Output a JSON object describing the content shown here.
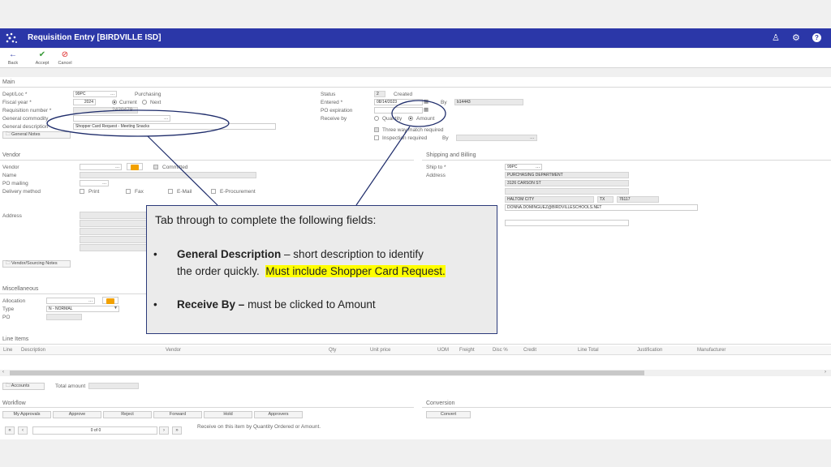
{
  "header": {
    "title": "Requisition Entry [BIRDVILLE ISD]",
    "icons": [
      "user-settings-icon",
      "gear-icon",
      "help-icon"
    ]
  },
  "toolbar": {
    "back": "Back",
    "accept": "Accept",
    "cancel": "Cancel"
  },
  "main": {
    "section": "Main",
    "dept_loc_label": "Dept/Loc *",
    "dept_loc_value": "99PC",
    "dept_loc_desc": "Purchasing",
    "fiscal_year_label": "Fiscal year *",
    "fiscal_year_value": "2024",
    "current_label": "Current",
    "next_label": "Next",
    "req_number_label": "Requisition number *",
    "req_number_value": "2420479",
    "general_commodity_label": "General commodity",
    "general_description_label": "General description",
    "general_description_value": "Shopper Card Request - Meeting Snacks",
    "general_notes_button": "General Notes",
    "status_label": "Status",
    "status_value": "2",
    "status_desc": "Created",
    "entered_label": "Entered *",
    "entered_value": "08/14/2023",
    "entered_by_label": "By",
    "entered_by_value": "b14443",
    "po_expiration_label": "PO expiration",
    "receive_by_label": "Receive by",
    "quantity_label": "Quantity",
    "amount_label": "Amount",
    "three_way_label": "Three way match required",
    "inspection_label": "Inspection required",
    "inspection_by_label": "By"
  },
  "vendor": {
    "section": "Vendor",
    "vendor_label": "Vendor",
    "committed_label": "Committed",
    "name_label": "Name",
    "po_mailing_label": "PO mailing",
    "delivery_method_label": "Delivery method",
    "print_label": "Print",
    "fax_label": "Fax",
    "email_label": "E-Mail",
    "eprocurement_label": "E-Procurement",
    "address_label": "Address",
    "sourcing_notes_button": "Vendor/Sourcing Notes"
  },
  "shipping": {
    "section": "Shipping and Billing",
    "ship_to_label": "Ship to *",
    "ship_to_value": "99PC",
    "address_label": "Address",
    "address_lines": [
      "PURCHASING DEPARTMENT",
      "3126 CARSON ST"
    ],
    "city": "HALTOM CITY",
    "state": "TX",
    "zip": "76117",
    "email": "DONNA.DOMINGUEZ@BIRDVILLESCHOOLS.NET"
  },
  "misc": {
    "section": "Miscellaneous",
    "allocation_label": "Allocation",
    "type_label": "Type",
    "type_value": "N - NORMAL",
    "po_label": "PO"
  },
  "line_items": {
    "section": "Line Items",
    "columns": [
      "Line",
      "Description",
      "Vendor",
      "Qty",
      "Unit price",
      "UOM",
      "Freight",
      "Disc %",
      "Credit",
      "Line Total",
      "Justification",
      "Manufacturer"
    ],
    "accounts_button": "Accounts",
    "total_amount_label": "Total amount"
  },
  "workflow": {
    "section": "Workflow",
    "buttons": [
      "My Approvals",
      "Approve",
      "Reject",
      "Forward",
      "Hold",
      "Approvers"
    ]
  },
  "conversion": {
    "section": "Conversion",
    "convert_button": "Convert"
  },
  "footer": {
    "pager_text": "0 of 0",
    "first": "«",
    "prev": "‹",
    "next": "›",
    "last": "»",
    "hint": "Receive on this item by Quantity Ordered or Amount."
  },
  "callout": {
    "heading": "Tab through to complete the following fields:",
    "bullet": "•",
    "item1_title": "General Description",
    "item1_text": " – short description to identify",
    "item1_line2": "the order quickly.",
    "item1_highlight": "Must include Shopper Card Request.",
    "item2_title": "Receive By –",
    "item2_text": " must be clicked to Amount"
  },
  "colors": {
    "titlebar": "#2b37a8",
    "callout_border": "#2b3a7a",
    "highlight": "#ffff00",
    "folder": "#f2a100"
  }
}
